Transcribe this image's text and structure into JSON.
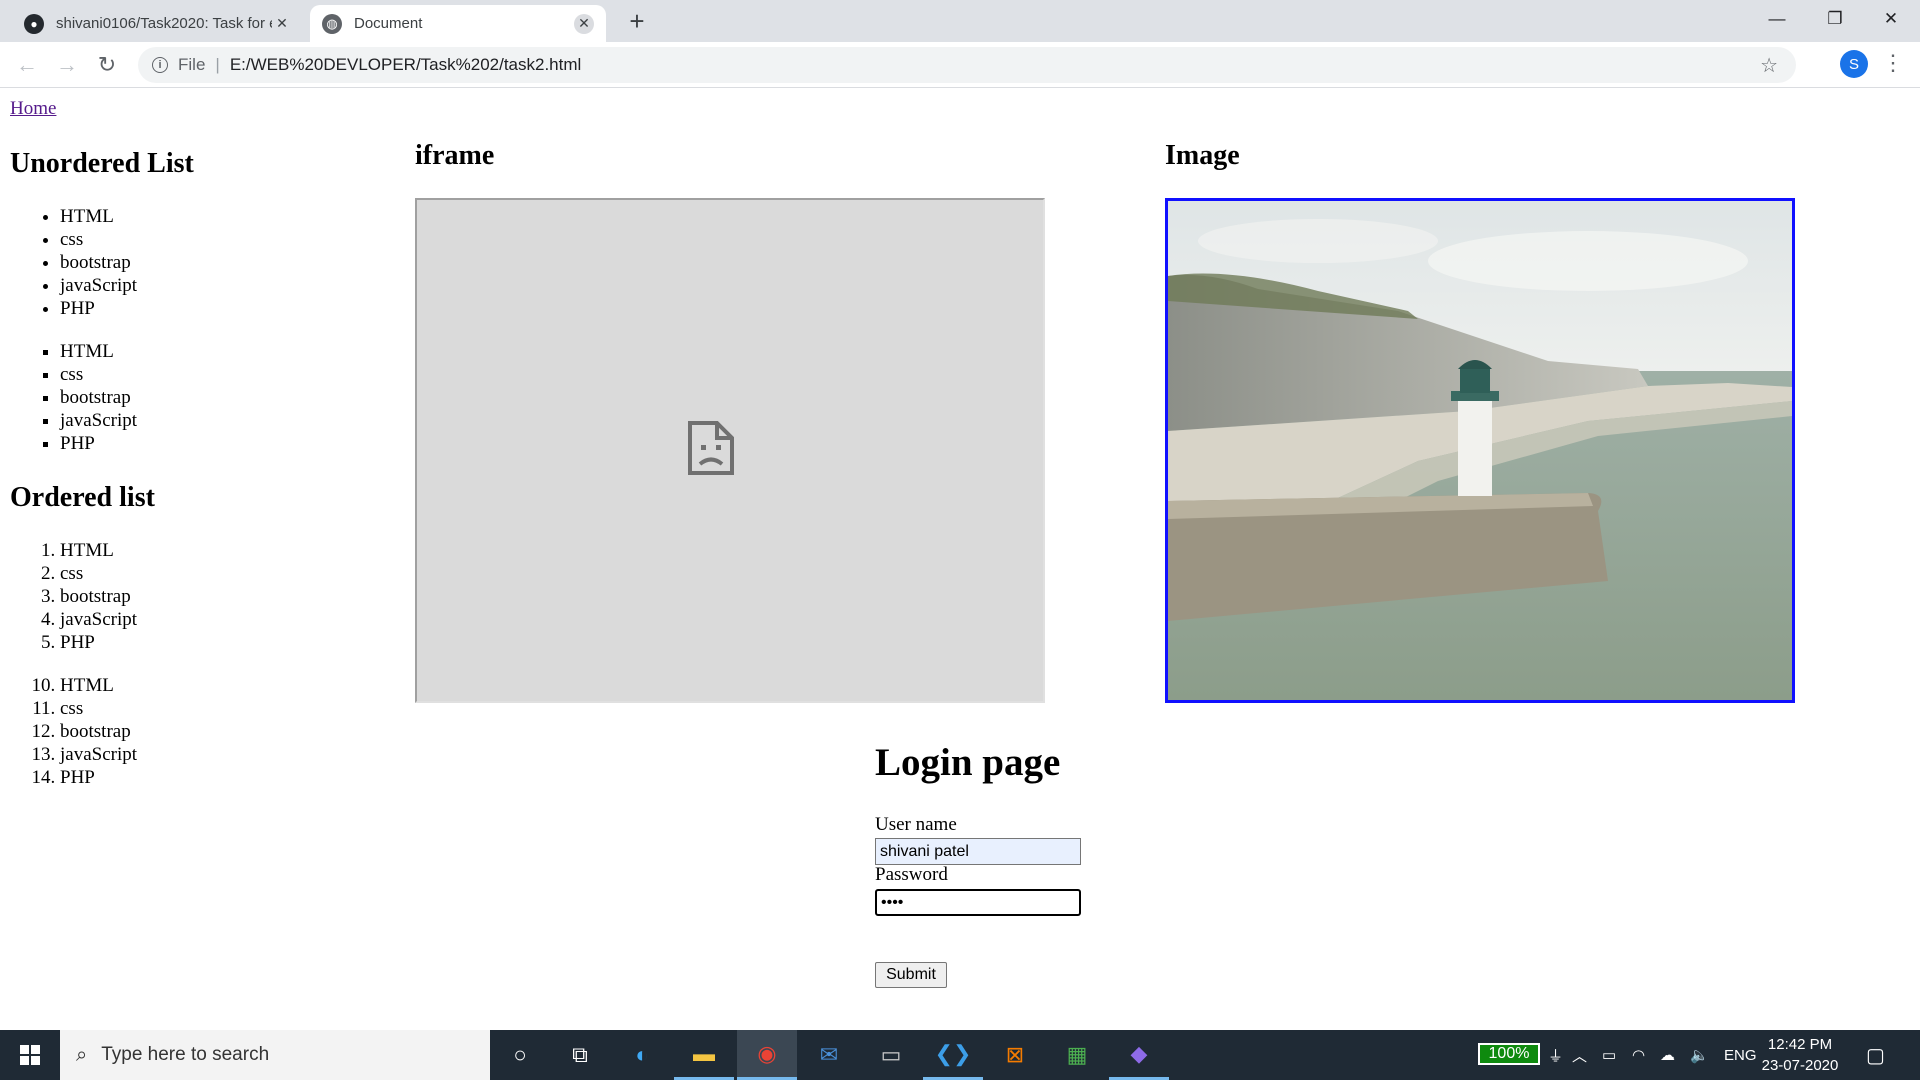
{
  "browser": {
    "tabs": [
      {
        "title": "shivani0106/Task2020: Task for e",
        "favicon": "github-icon",
        "active": false
      },
      {
        "title": "Document",
        "favicon": "globe-icon",
        "active": true
      }
    ],
    "new_tab": "+",
    "address": {
      "scheme": "File",
      "url": "E:/WEB%20DEVLOPER/Task%202/task2.html"
    },
    "profile_initial": "S"
  },
  "page": {
    "home_link": "Home",
    "unordered_heading": "Unordered List",
    "ordered_heading": "Ordered list",
    "list_disc": [
      "HTML",
      "css",
      "bootstrap",
      "javaScript",
      "PHP"
    ],
    "list_square": [
      "HTML",
      "css",
      "bootstrap",
      "javaScript",
      "PHP"
    ],
    "list_ordered_1": [
      "HTML",
      "css",
      "bootstrap",
      "javaScript",
      "PHP"
    ],
    "list_ordered_1_start": 1,
    "list_ordered_2": [
      "HTML",
      "css",
      "bootstrap",
      "javaScript",
      "PHP"
    ],
    "list_ordered_2_start": 10,
    "iframe_heading": "iframe",
    "image_heading": "Image",
    "login": {
      "title": "Login page",
      "username_label": "User name",
      "username_value": "shivani patel",
      "password_label": "Password",
      "password_value": "••••",
      "submit_label": "Submit"
    }
  },
  "taskbar": {
    "search_placeholder": "Type here to search",
    "battery": "100%",
    "language": "ENG",
    "time": "12:42 PM",
    "date": "23-07-2020"
  },
  "colors": {
    "link_visited": "#551a8b",
    "image_border": "#1010ff",
    "taskbar_bg": "#1f2a35",
    "autofill_bg": "#e8f0fe"
  }
}
